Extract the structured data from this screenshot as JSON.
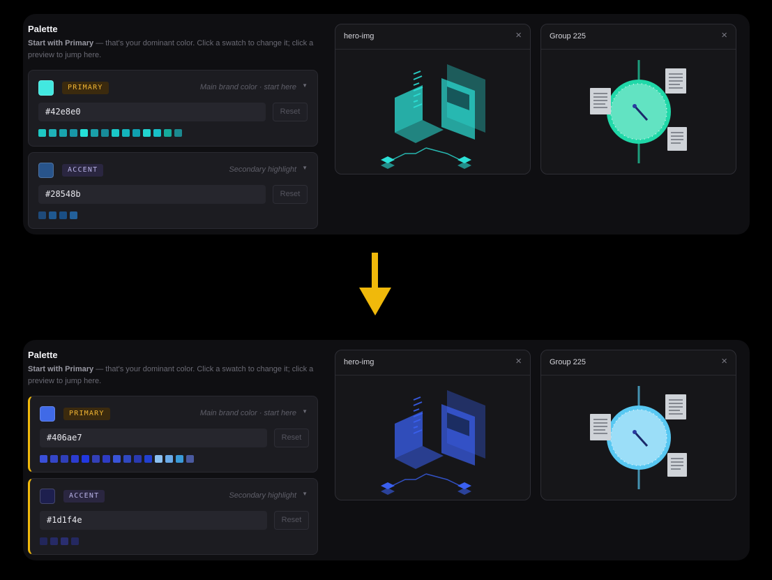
{
  "palette": {
    "title": "Palette",
    "desc_strong": "Start with Primary",
    "desc_rest": " — that's your dominant color. Click a swatch to change it; click a preview to jump here."
  },
  "previews": {
    "hero_title": "hero-img",
    "group_title": "Group 225",
    "close_glyph": "×"
  },
  "before": {
    "primary": {
      "label": "PRIMARY",
      "hint": "Main brand color · start here",
      "hex": "#42e8e0",
      "reset": "Reset",
      "ramp": [
        "#1ec8c4",
        "#1fb2b8",
        "#19a4ae",
        "#1896a6",
        "#25e0d8",
        "#1aa0aa",
        "#178c9a",
        "#1ac8c8",
        "#14b4bc",
        "#10a0b0",
        "#22d4d0",
        "#18c0c8",
        "#15aa9c",
        "#1b8a90"
      ]
    },
    "accent": {
      "label": "ACCENT",
      "hint": "Secondary highlight",
      "hex": "#28548b",
      "reset": "Reset",
      "ramp": [
        "#1e4a7a",
        "#1f5890",
        "#1a4e84",
        "#23609a"
      ]
    },
    "hero_color": "#2ce0d6",
    "group_color": "#20d8a8"
  },
  "after": {
    "primary": {
      "label": "PRIMARY",
      "hint": "Main brand color · start here",
      "hex": "#406ae7",
      "reset": "Reset",
      "ramp": [
        "#3a4fd8",
        "#3446c8",
        "#2f3fba",
        "#2c3cd0",
        "#2238e0",
        "#3340b8",
        "#2e3cc4",
        "#3a54d8",
        "#3048c0",
        "#2a3ab0",
        "#2240d0",
        "#8cc0f0",
        "#6aaae8",
        "#3a9ad8",
        "#4a5aa0"
      ]
    },
    "accent": {
      "label": "ACCENT",
      "hint": "Secondary highlight",
      "hex": "#1d1f4e",
      "reset": "Reset",
      "ramp": [
        "#22265a",
        "#262a66",
        "#2a2e70",
        "#242860"
      ]
    },
    "hero_color": "#3a60f0",
    "group_color": "#58c8f2"
  },
  "arrow_color": "#f0b90b"
}
